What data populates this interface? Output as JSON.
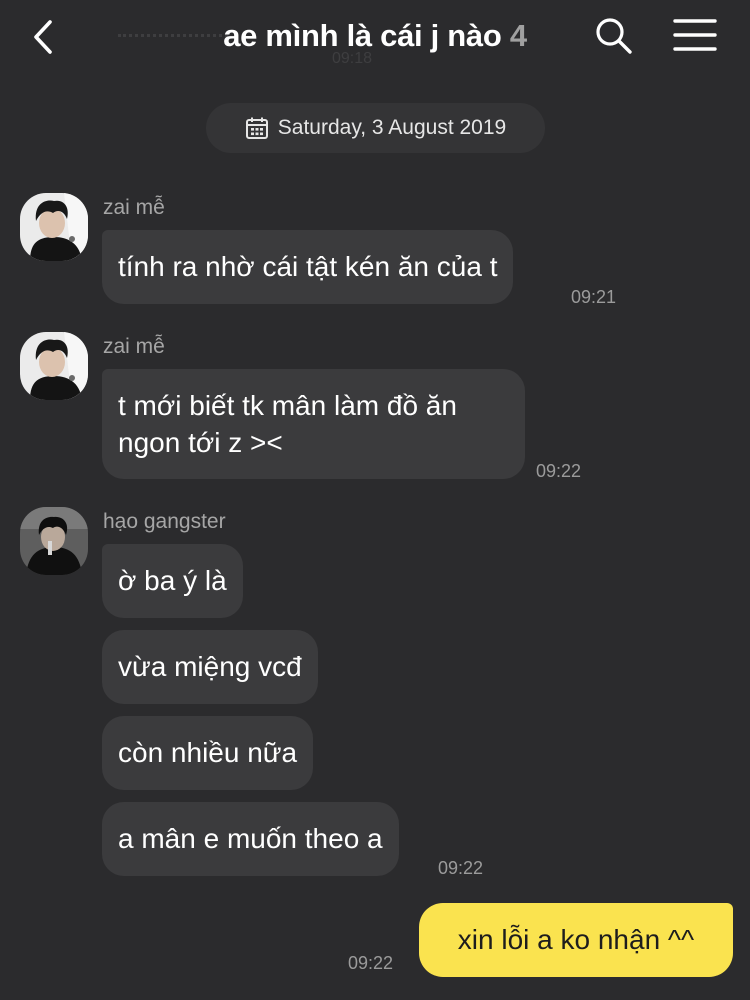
{
  "header": {
    "title": "ae mình là cái j nào",
    "member_count": "4"
  },
  "previous_message": {
    "time": "09:18"
  },
  "date_separator": "Saturday, 3 August 2019",
  "messages": [
    {
      "sender": "zai mễ",
      "text": "tính ra nhờ cái tật kén ăn của t",
      "time": "09:21"
    },
    {
      "sender": "zai mễ",
      "text": "t mới biết tk mân làm đồ ăn ngon tới z ><",
      "time": "09:22"
    },
    {
      "sender": "hạo gangster",
      "texts": [
        "ờ ba ý là",
        "vừa miệng vcđ",
        "còn nhiều nữa",
        "a mân e muốn theo a"
      ],
      "time": "09:22"
    }
  ],
  "my_message": {
    "text": "xin lỗi a ko nhận ^^",
    "time": "09:22"
  },
  "colors": {
    "background": "#2b2b2d",
    "bubble": "#3b3b3d",
    "my_bubble": "#fae34f",
    "meta_text": "#9b9b9b"
  },
  "icons": [
    "back-arrow-icon",
    "search-icon",
    "hamburger-menu-icon",
    "calendar-icon"
  ]
}
